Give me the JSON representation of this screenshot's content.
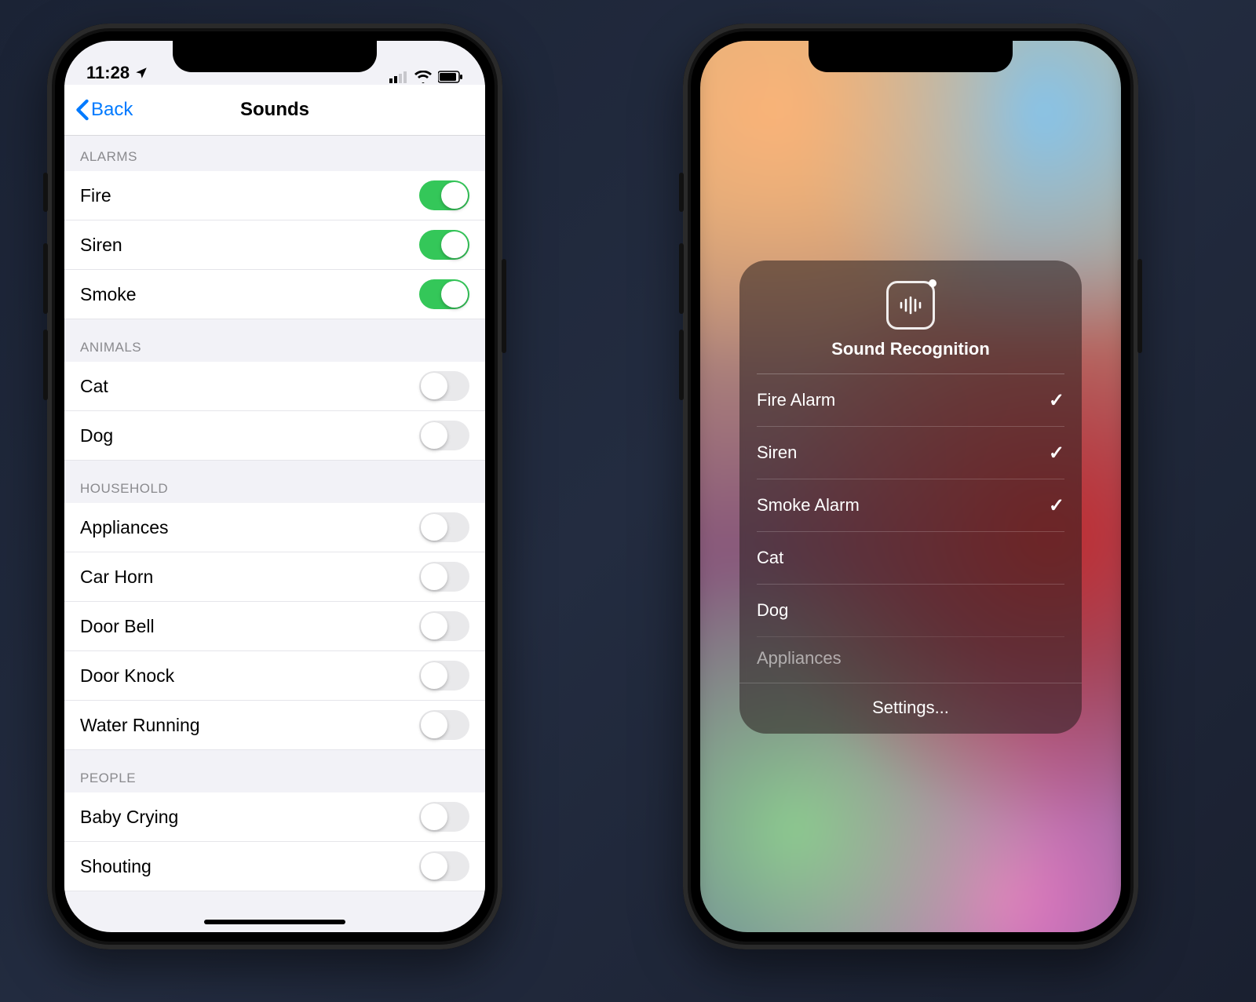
{
  "left": {
    "status": {
      "time": "11:28"
    },
    "nav": {
      "back": "Back",
      "title": "Sounds"
    },
    "sections": [
      {
        "header": "ALARMS",
        "rows": [
          {
            "label": "Fire",
            "on": true
          },
          {
            "label": "Siren",
            "on": true
          },
          {
            "label": "Smoke",
            "on": true
          }
        ]
      },
      {
        "header": "ANIMALS",
        "rows": [
          {
            "label": "Cat",
            "on": false
          },
          {
            "label": "Dog",
            "on": false
          }
        ]
      },
      {
        "header": "HOUSEHOLD",
        "rows": [
          {
            "label": "Appliances",
            "on": false
          },
          {
            "label": "Car Horn",
            "on": false
          },
          {
            "label": "Door Bell",
            "on": false
          },
          {
            "label": "Door Knock",
            "on": false
          },
          {
            "label": "Water Running",
            "on": false
          }
        ]
      },
      {
        "header": "PEOPLE",
        "rows": [
          {
            "label": "Baby Crying",
            "on": false
          },
          {
            "label": "Shouting",
            "on": false
          }
        ]
      }
    ]
  },
  "right": {
    "popup": {
      "title": "Sound Recognition",
      "items": [
        {
          "label": "Fire Alarm",
          "checked": true
        },
        {
          "label": "Siren",
          "checked": true
        },
        {
          "label": "Smoke Alarm",
          "checked": true
        },
        {
          "label": "Cat",
          "checked": false
        },
        {
          "label": "Dog",
          "checked": false
        },
        {
          "label": "Appliances",
          "checked": false,
          "faded": true
        }
      ],
      "footer": "Settings..."
    }
  }
}
